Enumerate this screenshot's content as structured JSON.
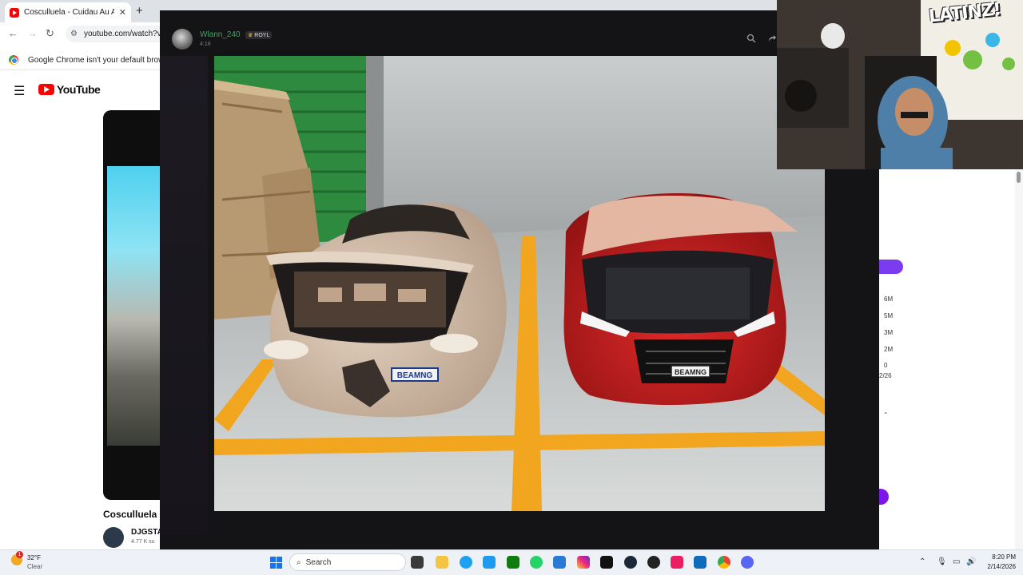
{
  "browser": {
    "tab_title": "Cosculluela - Cuidau Au Au (Official",
    "tab_close": "✕",
    "new_tab": "+",
    "url": "youtube.com/watch?v=",
    "infobar_text": "Google Chrome isn't your default browser"
  },
  "youtube": {
    "logo_text": "YouTube",
    "video_title": "Cosculluela",
    "channel_name": "DJGSTA",
    "channel_subs": "4.77 K su",
    "chart_ticks": [
      "6M",
      "5M",
      "3M",
      "2M",
      "0"
    ],
    "chart_date": "2/26"
  },
  "viewer": {
    "username": "Wlann_240",
    "badge": "ROYL",
    "timestamp": "4:18",
    "plate_left": "BEAMNG",
    "plate_right": "BEAMNG"
  },
  "webcam": {
    "wall_art_text": "LATINZ!"
  },
  "taskbar": {
    "weather_alert": "1",
    "temperature": "32°F",
    "condition": "Clear",
    "search_label": "Search",
    "time": "8:20 PM",
    "date": "2/14/2026"
  },
  "colors": {
    "accent_purple": "#7b3cf0",
    "username_green": "#3ba55d",
    "youtube_red": "#ff0000"
  }
}
